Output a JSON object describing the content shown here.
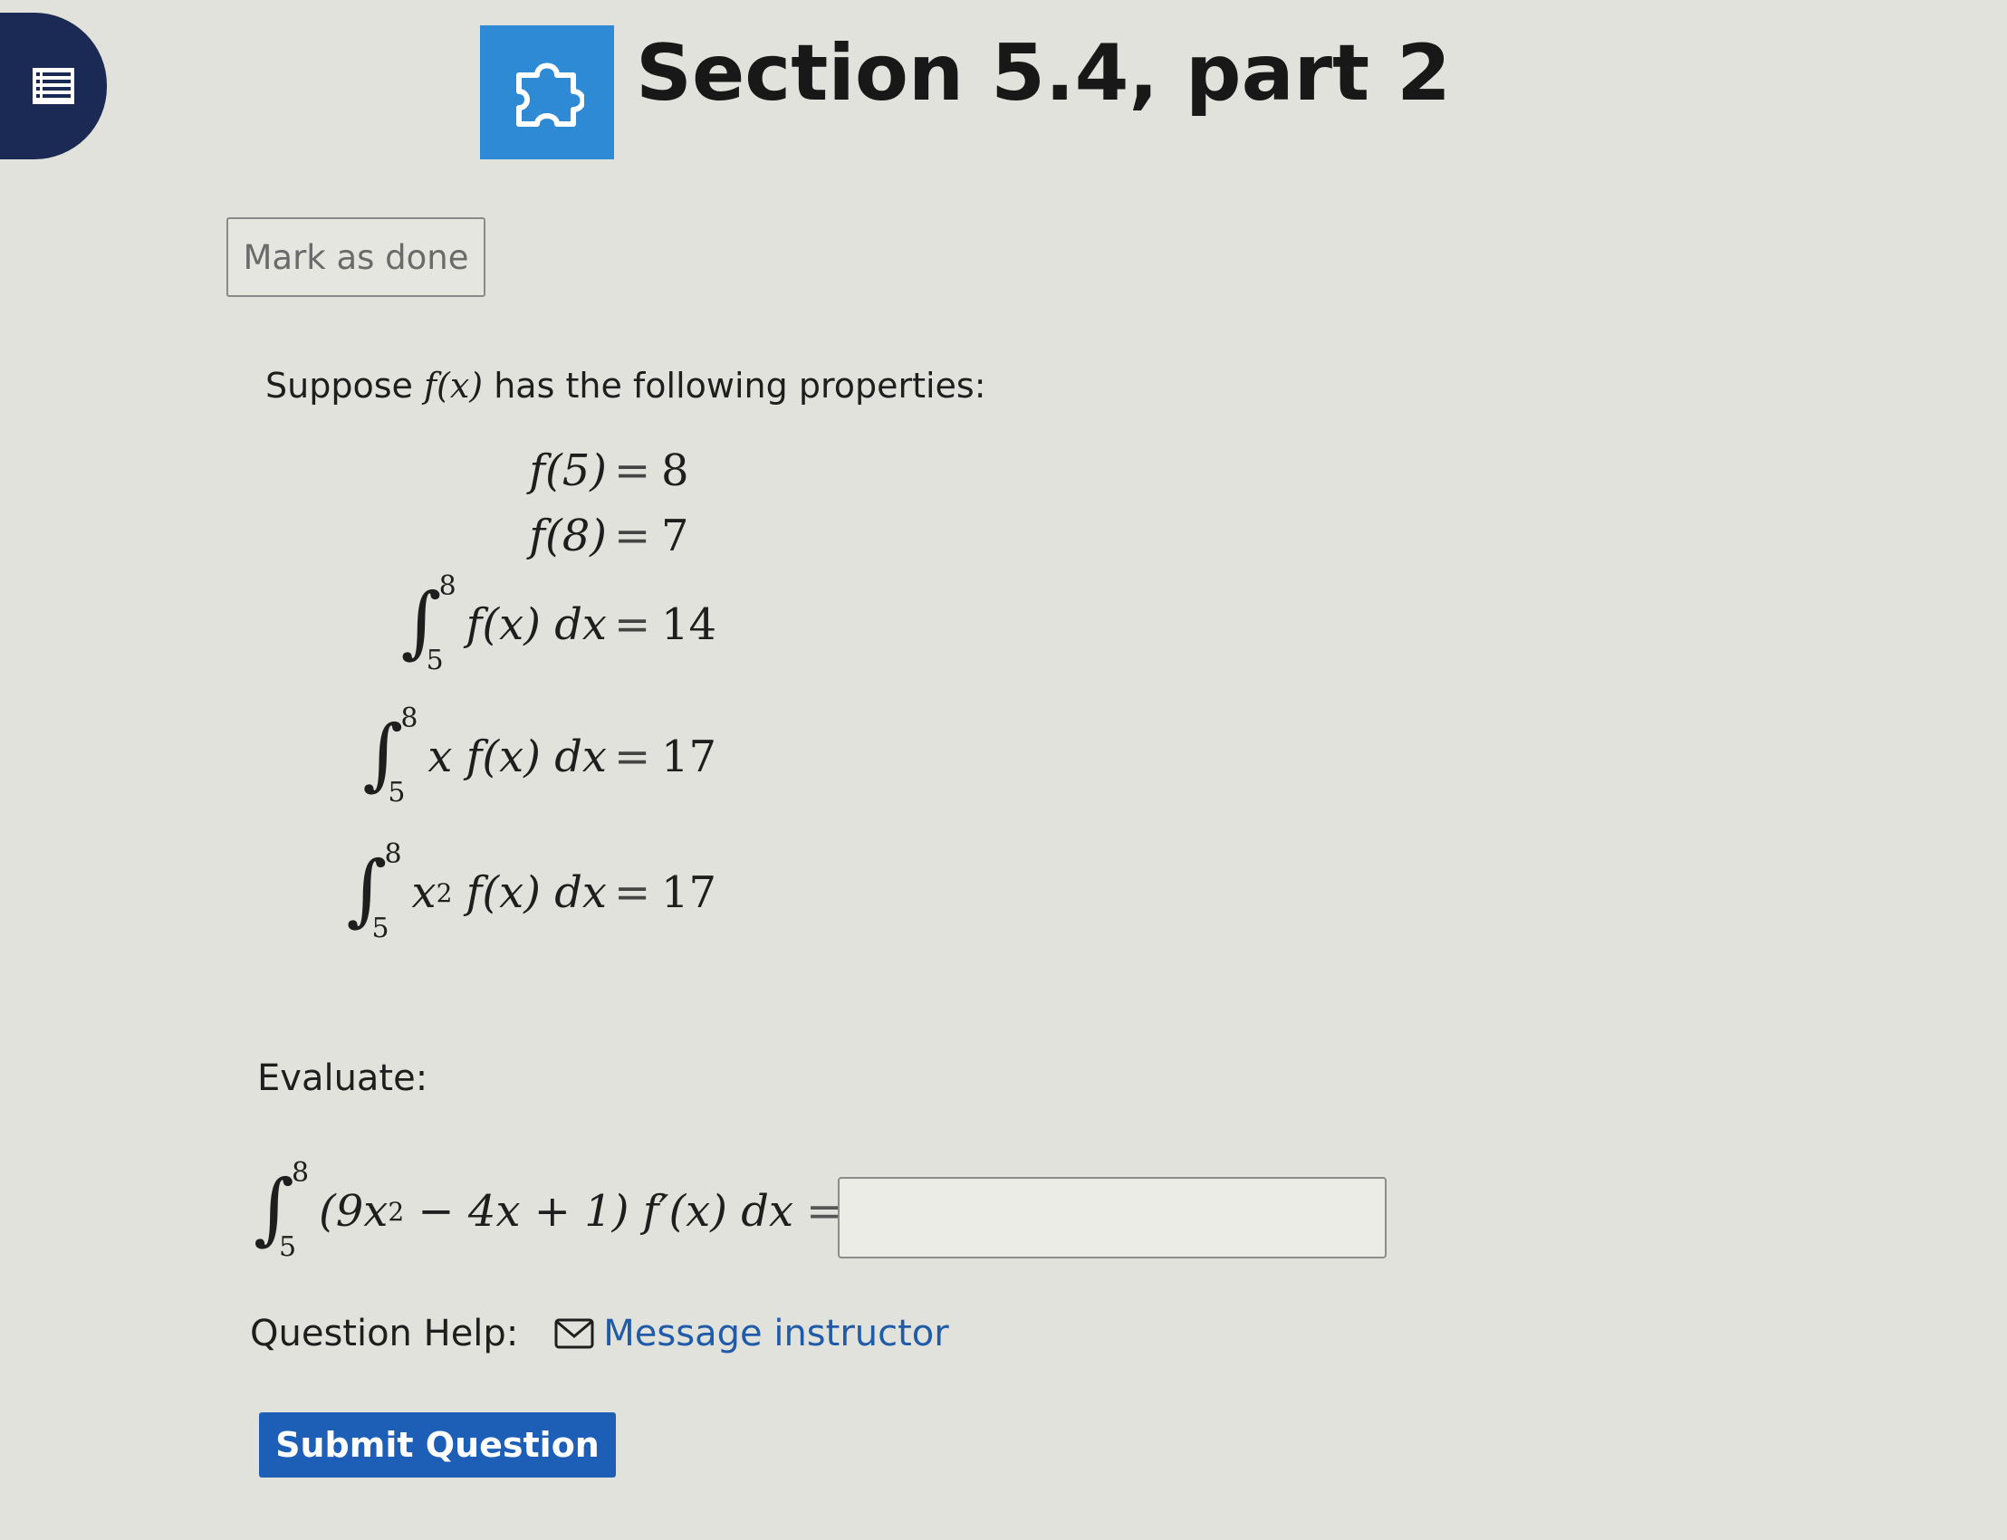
{
  "header": {
    "title": "Section 5.4, part 2",
    "menu_icon": "list-icon",
    "section_icon": "puzzle-piece-icon",
    "accent_color": "#2f8ad6"
  },
  "actions": {
    "mark_done_label": "Mark as done"
  },
  "question": {
    "intro_before": "Suppose",
    "intro_func": "f(x)",
    "intro_after": "has the following properties:",
    "properties": [
      {
        "lhs": "f(5)",
        "rhs": "8"
      },
      {
        "lhs": "f(8)",
        "rhs": "7"
      },
      {
        "integral_upper": "8",
        "integral_lower": "5",
        "integrand": "f(x) dx",
        "rhs": "14"
      },
      {
        "integral_upper": "8",
        "integral_lower": "5",
        "integrand": "x f(x) dx",
        "rhs": "17"
      },
      {
        "integral_upper": "8",
        "integral_lower": "5",
        "integrand_base": "x",
        "integrand_exp": "2",
        "integrand_rest": " f(x) dx",
        "rhs": "17"
      }
    ],
    "evaluate_label": "Evaluate:",
    "target": {
      "upper": "8",
      "lower": "5",
      "open": "(9x",
      "exp": "2",
      "rest": " − 4x + 1) f′(x) dx",
      "equals": "="
    },
    "answer_value": ""
  },
  "help": {
    "label": "Question Help:",
    "link_icon": "envelope-icon",
    "link_label": "Message instructor"
  },
  "submit_label": "Submit Question",
  "submit_color": "#1d5eb6"
}
